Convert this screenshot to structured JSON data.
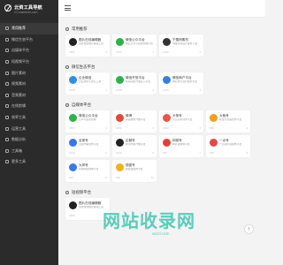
{
  "logo": {
    "title": "云资工具导航",
    "subtitle": "CO.awedzer.com"
  },
  "sidebar": {
    "items": [
      {
        "label": "常用推荐"
      },
      {
        "label": "微信生态平台"
      },
      {
        "label": "自媒体平台"
      },
      {
        "label": "短视频平台"
      },
      {
        "label": "图片素材"
      },
      {
        "label": "视频素材"
      },
      {
        "label": "音频素材"
      },
      {
        "label": "在线剪辑"
      },
      {
        "label": "效率工具"
      },
      {
        "label": "运营工具"
      },
      {
        "label": "数据分析"
      },
      {
        "label": "工具箱"
      },
      {
        "label": "更多工具"
      }
    ]
  },
  "topbar": {
    "menu_icon": "hamburger-icon"
  },
  "sections": [
    {
      "title": "常用推荐",
      "cards": [
        {
          "name": "图片在线编辑器",
          "desc": "免费在线图片编辑工具",
          "stat": "1880",
          "rank": "1"
        },
        {
          "name": "微信公众平台",
          "desc": "微信公众号运营管理平台",
          "stat": "2355",
          "rank": "2"
        },
        {
          "name": "千图网素材",
          "desc": "海量高清设计素材下载",
          "stat": "1320",
          "rank": "3"
        }
      ]
    },
    {
      "title": "微信生态平台",
      "cards": [
        {
          "name": "企业微信",
          "desc": "企业通讯与办公工具",
          "stat": "1230",
          "rank": "1"
        },
        {
          "name": "微信开放平台",
          "desc": "移动应用开发接入平台",
          "stat": "1430",
          "rank": "2"
        },
        {
          "name": "微信商户平台",
          "desc": "微信支付商户服务平台",
          "stat": "1234",
          "rank": "3"
        }
      ]
    },
    {
      "title": "自媒体平台",
      "cards": [
        {
          "name": "微信公众平台",
          "desc": "公众号运营管理",
          "stat": "2355",
          "rank": "1"
        },
        {
          "name": "微博",
          "desc": "新浪微博开放平台",
          "stat": "1480",
          "rank": "2"
        },
        {
          "name": "头条号",
          "desc": "今日头条创作平台",
          "stat": "1390",
          "rank": "3"
        },
        {
          "name": "大鱼号",
          "desc": "阿里大文娱创作平台",
          "stat": "980",
          "rank": "4"
        },
        {
          "name": "百家号",
          "desc": "百度内容创作平台",
          "stat": "1100",
          "rank": "5"
        },
        {
          "name": "企鹅号",
          "desc": "腾讯内容开放平台",
          "stat": "1010",
          "rank": "6"
        },
        {
          "name": "网易号",
          "desc": "网易自媒体平台",
          "stat": "870",
          "rank": "7"
        },
        {
          "name": "一点号",
          "desc": "一点资讯自媒体平台",
          "stat": "760",
          "rank": "8"
        },
        {
          "name": "大风号",
          "desc": "凤凰网自媒体平台",
          "stat": "650",
          "rank": "9"
        },
        {
          "name": "搜狐号",
          "desc": "搜狐自媒体平台",
          "stat": "690",
          "rank": "10"
        }
      ]
    },
    {
      "title": "短视频平台",
      "cards": [
        {
          "name": "图片在线编辑器",
          "desc": "免费在线图片编辑工具",
          "stat": "1880",
          "rank": "1"
        }
      ]
    }
  ],
  "watermark": {
    "text": "网站收录网",
    "sub": "wzsll.com"
  },
  "colors": {
    "ic0": "#222222",
    "ic1": "#2fb14a",
    "ic2": "#333333",
    "ic3": "#2f8fe0",
    "ic4": "#2fb14a",
    "ic5": "#3a7fd6",
    "ic6": "#2fb14a",
    "ic7": "#e04a3a",
    "ic8": "#e8554a",
    "ic9": "#f0a020",
    "ic10": "#3c77e6",
    "ic11": "#222222",
    "ic12": "#e0403a",
    "ic13": "#e04a4a",
    "ic14": "#3c77e6",
    "ic15": "#f0b020",
    "ic16": "#222222"
  }
}
